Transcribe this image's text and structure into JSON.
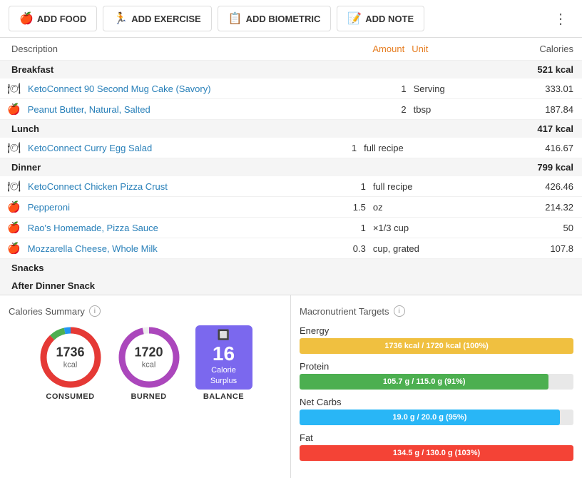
{
  "toolbar": {
    "buttons": [
      {
        "id": "add-food",
        "icon": "🍎",
        "label": "ADD FOOD"
      },
      {
        "id": "add-exercise",
        "icon": "🏃",
        "label": "ADD EXERCISE"
      },
      {
        "id": "add-biometric",
        "icon": "📋",
        "label": "ADD BIOMETRIC"
      },
      {
        "id": "add-note",
        "icon": "📝",
        "label": "ADD NOTE"
      }
    ]
  },
  "table": {
    "headers": {
      "description": "Description",
      "amount": "Amount",
      "unit": "Unit",
      "calories": "Calories"
    },
    "sections": [
      {
        "name": "Breakfast",
        "kcal": "521 kcal",
        "items": [
          {
            "icon": "🍽",
            "name": "KetoConnect 90 Second Mug Cake (Savory)",
            "amount": "1",
            "unit": "Serving",
            "calories": "333.01"
          },
          {
            "icon": "🍎",
            "name": "Peanut Butter, Natural, Salted",
            "amount": "2",
            "unit": "tbsp",
            "calories": "187.84"
          }
        ]
      },
      {
        "name": "Lunch",
        "kcal": "417 kcal",
        "items": [
          {
            "icon": "🍽",
            "name": "KetoConnect Curry Egg Salad",
            "amount": "1",
            "unit": "full recipe",
            "calories": "416.67"
          }
        ]
      },
      {
        "name": "Dinner",
        "kcal": "799 kcal",
        "items": [
          {
            "icon": "🍽",
            "name": "KetoConnect Chicken Pizza Crust",
            "amount": "1",
            "unit": "full recipe",
            "calories": "426.46"
          },
          {
            "icon": "🍎",
            "name": "Pepperoni",
            "amount": "1.5",
            "unit": "oz",
            "calories": "214.32"
          },
          {
            "icon": "🍎",
            "name": "Rao's Homemade, Pizza Sauce",
            "amount": "1",
            "unit": "×1/3 cup",
            "calories": "50"
          },
          {
            "icon": "🍎",
            "name": "Mozzarella Cheese, Whole Milk",
            "amount": "0.3",
            "unit": "cup, grated",
            "calories": "107.8"
          }
        ]
      },
      {
        "name": "Snacks",
        "kcal": "",
        "items": []
      },
      {
        "name": "After Dinner Snack",
        "kcal": "",
        "items": [],
        "sub": true
      }
    ]
  },
  "calories_summary": {
    "title": "Calories Summary",
    "consumed": {
      "label": "CONSUMED",
      "value": "1736",
      "unit": "kcal"
    },
    "burned": {
      "label": "BURNED",
      "value": "1720",
      "unit": "kcal"
    },
    "balance": {
      "label": "BALANCE",
      "value": "16",
      "sub": "Calorie\nSurplus"
    }
  },
  "macros": {
    "title": "Macronutrient Targets",
    "items": [
      {
        "name": "Energy",
        "text": "1736 kcal / 1720 kcal (100%)",
        "pct": 100,
        "color": "#f0c040"
      },
      {
        "name": "Protein",
        "text": "105.7 g / 115.0 g (91%)",
        "pct": 91,
        "color": "#4caf50"
      },
      {
        "name": "Net Carbs",
        "text": "19.0 g / 20.0 g (95%)",
        "pct": 95,
        "color": "#29b6f6"
      },
      {
        "name": "Fat",
        "text": "134.5 g / 130.0 g (103%)",
        "pct": 100,
        "color": "#f44336"
      }
    ]
  }
}
